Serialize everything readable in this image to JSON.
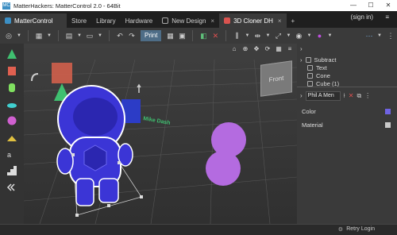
{
  "window": {
    "title": "MatterHackers: MatterControl 2.0 - 64Bit",
    "app_icon": "MC",
    "controls": [
      "—",
      "☐",
      "✕"
    ]
  },
  "tabs": [
    {
      "label": "MatterControl",
      "type": "app"
    },
    {
      "label": "Store"
    },
    {
      "label": "Library"
    },
    {
      "label": "Hardware"
    },
    {
      "label": "New Design",
      "close": "×"
    },
    {
      "label": "3D Cloner DH",
      "close": "×",
      "selected": true
    },
    {
      "label": "+"
    }
  ],
  "signin": "(sign in)",
  "menu_icon": "≡",
  "toolbar": {
    "print_label": "Print"
  },
  "viewport": {
    "cube_label": "Front",
    "text_on_bed": "Mike Dash"
  },
  "tree": {
    "items": [
      "Subtract",
      "Text",
      "Cone",
      "Cube (1)"
    ]
  },
  "object": {
    "name": "Phil A Men"
  },
  "properties": [
    {
      "label": "Color",
      "swatch": "#6f63e3"
    },
    {
      "label": "Material",
      "swatch": "#c9c9c9"
    }
  ],
  "status": {
    "retry": "Retry Login"
  },
  "colors": {
    "astronaut": "#3b35d6",
    "spheres": "#b46be0",
    "titlebar": "#ffffff"
  }
}
